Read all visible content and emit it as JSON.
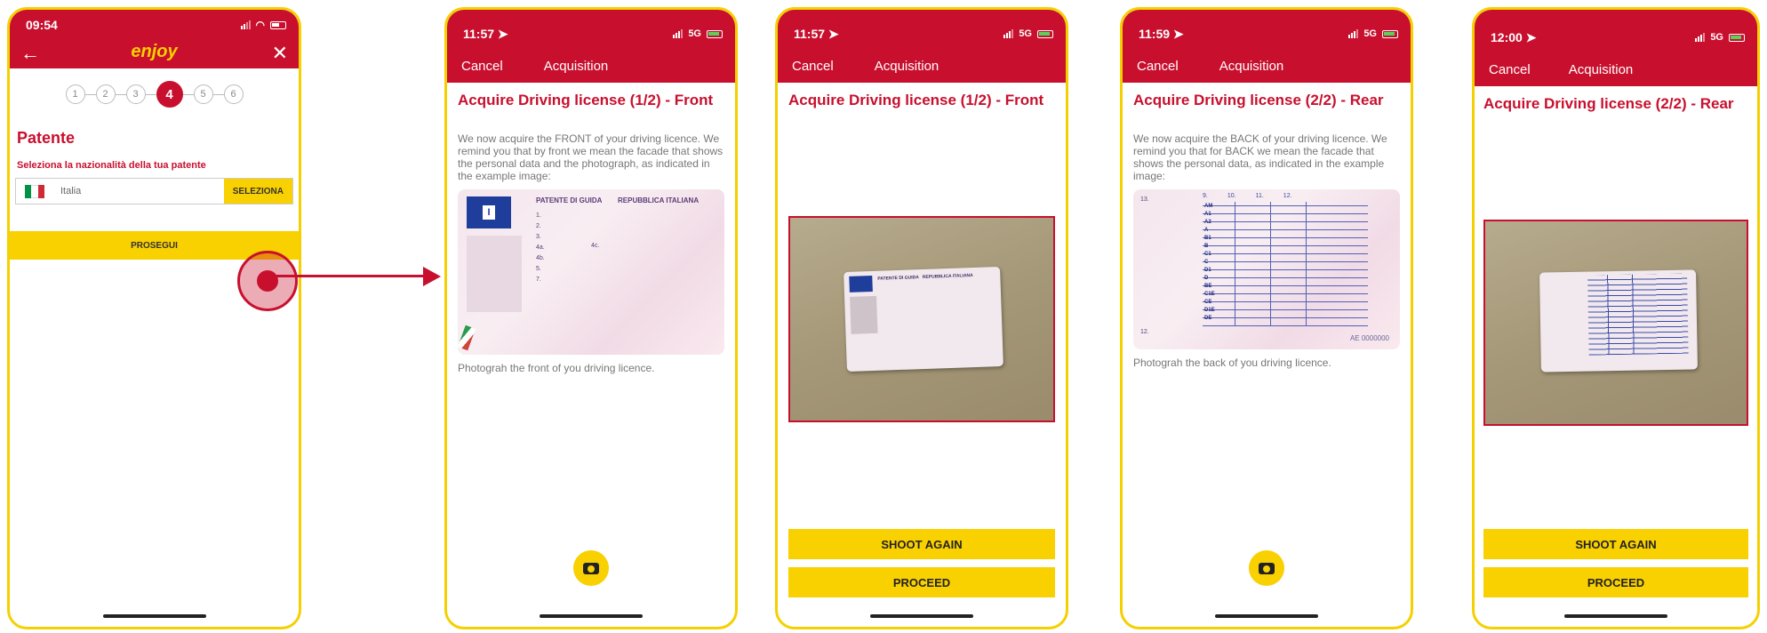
{
  "colors": {
    "brand_red": "#c8102e",
    "accent_yellow": "#f9d000",
    "frame": "#f5d000"
  },
  "screen1": {
    "time": "09:54",
    "logo": "enjoy",
    "steps": [
      "1",
      "2",
      "3",
      "4",
      "5",
      "6"
    ],
    "active_step": "4",
    "title": "Patente",
    "subtitle": "Seleziona la nazionalità della tua patente",
    "nationality_value": "Italia",
    "select_label": "SELEZIONA",
    "continue_label": "PROSEGUI"
  },
  "screen2": {
    "time": "11:57",
    "network": "5G",
    "nav_cancel": "Cancel",
    "nav_title": "Acquisition",
    "title": "Acquire Driving license (1/2) - Front",
    "description": "We now acquire the FRONT of your driving licence. We remind you that by front we mean the facade that shows the personal data and the photograph, as indicated in the example image:",
    "example": {
      "header_left": "PATENTE DI GUIDA",
      "header_right": "REPUBBLICA ITALIANA",
      "country_code": "I",
      "fields": [
        "1.",
        "2.",
        "3.",
        "4a.",
        "4b.",
        "5.",
        "7."
      ],
      "field_4c": "4c."
    },
    "footer": "Photograh the front of you driving licence."
  },
  "screen3": {
    "time": "11:57",
    "network": "5G",
    "nav_cancel": "Cancel",
    "nav_title": "Acquisition",
    "title": "Acquire Driving license (1/2) - Front",
    "card_header": "PATENTE DI GUIDA   REPUBBLICA ITALIANA",
    "shoot_again": "SHOOT AGAIN",
    "proceed": "PROCEED"
  },
  "screen4": {
    "time": "11:59",
    "network": "5G",
    "nav_cancel": "Cancel",
    "nav_title": "Acquisition",
    "title": "Acquire Driving license (2/2) - Rear",
    "description": "We now acquire the BACK of your driving licence. We remind you that for BACK we mean the facade that shows the personal data, as indicated in the example image:",
    "example": {
      "col9": "9.",
      "col10": "10.",
      "col11": "11.",
      "col12": "12.",
      "row13": "13.",
      "row12": "12.",
      "categories": [
        "AM",
        "A1",
        "A2",
        "A",
        "B1",
        "B",
        "C1",
        "C",
        "D1",
        "D",
        "BE",
        "C1E",
        "CE",
        "D1E",
        "DE"
      ],
      "serial": "AE 0000000"
    },
    "footer": "Photograh the back  of you driving licence."
  },
  "screen5": {
    "time": "12:00",
    "network": "5G",
    "nav_cancel": "Cancel",
    "nav_title": "Acquisition",
    "title": "Acquire Driving license (2/2) - Rear",
    "shoot_again": "SHOOT AGAIN",
    "proceed": "PROCEED"
  }
}
